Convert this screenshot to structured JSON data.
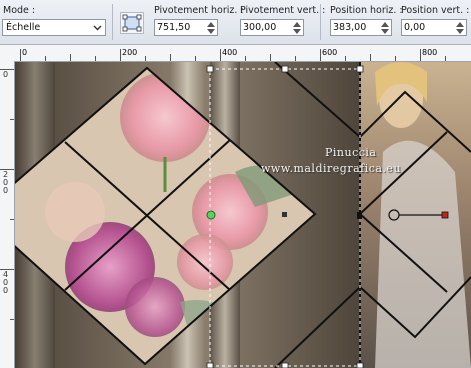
{
  "toolbar": {
    "mode": {
      "label": "Mode :",
      "value": "Échelle"
    },
    "pivot_h": {
      "label": "Pivotement horiz. :",
      "value": "751,50"
    },
    "pivot_v": {
      "label": "Pivotement vert. :",
      "value": "300,00"
    },
    "pos_h": {
      "label": "Position horiz. :",
      "value": "383,00"
    },
    "pos_v": {
      "label": "Position vert. :",
      "value": "0,00"
    }
  },
  "ruler": {
    "top": [
      "0",
      "200",
      "400",
      "600",
      "800"
    ],
    "left": [
      "0",
      "200",
      "400"
    ]
  },
  "watermark": {
    "line1": "Pinuccia",
    "line2": "www.maldiregrafica.eu"
  },
  "colors": {
    "toolbar_bg": "#dfe3ea",
    "canvas_bg": "#6d6356",
    "frame_line": "#111111",
    "handle_green": "#2aa02a",
    "selection_dash": "#ffffff"
  },
  "icons": {
    "pick_tool": "pick-tool-icon",
    "dropdown": "chevron-down-icon",
    "spin_up": "spin-up-icon",
    "spin_down": "spin-down-icon"
  }
}
